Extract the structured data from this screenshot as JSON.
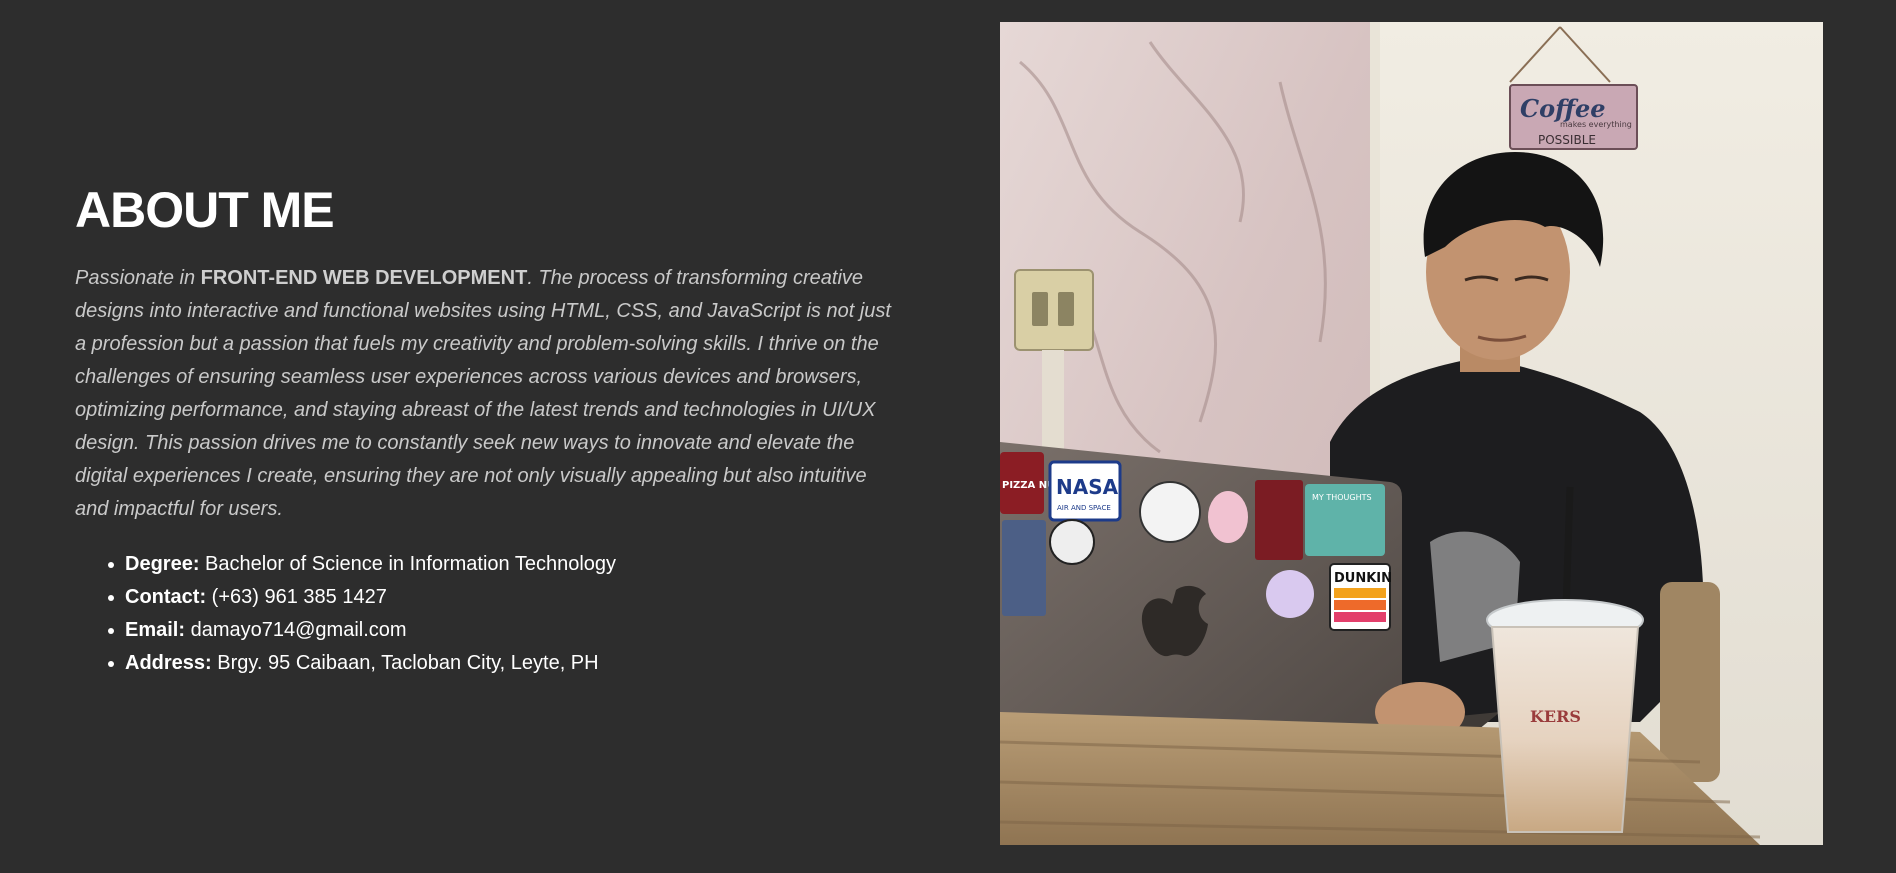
{
  "about": {
    "title": "ABOUT ME",
    "intro_lead": "Passionate in",
    "intro_highlight": "FRONT-END WEB DEVELOPMENT",
    "intro_rest": ". The process of transforming creative designs into interactive and functional websites using HTML, CSS, and JavaScript is not just a profession but a passion that fuels my creativity and problem-solving skills. I thrive on the challenges of ensuring seamless user experiences across various devices and browsers, optimizing performance, and staying abreast of the latest trends and technologies in UI/UX design. This passion drives me to constantly seek new ways to innovate and elevate the digital experiences I create, ensuring they are not only visually appealing but also intuitive and impactful for users."
  },
  "details": [
    {
      "label": "Degree:",
      "value": "Bachelor of Science in Information Technology"
    },
    {
      "label": "Contact:",
      "value": "(+63) 961 385 1427"
    },
    {
      "label": "Email:",
      "value": "damayo714@gmail.com"
    },
    {
      "label": "Address:",
      "value": "Brgy. 95 Caibaan, Tacloban City, Leyte, PH"
    }
  ],
  "photo": {
    "sign_line1": "Coffee",
    "sign_line2": "makes everything",
    "sign_line3": "POSSIBLE",
    "sticker_nasa": "NASA",
    "sticker_nasa_sub": "AIR AND SPACE",
    "sticker_dunkin": "DUNKIN",
    "sticker_pizza": "PIZZA NUT",
    "sticker_thoughts": "MY THOUGHTS",
    "cup_text": "KERS"
  },
  "colors": {
    "background": "#2d2d2d",
    "heading": "#ffffff",
    "body_text": "#c9c9c9"
  }
}
